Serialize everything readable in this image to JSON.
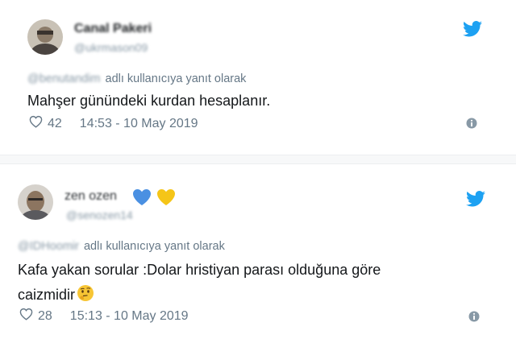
{
  "tweets": [
    {
      "name": "Canal Pakeri",
      "handle": "@ukrmason09",
      "reply_user": "@benutandim",
      "reply_suffix": "adlı kullanıcıya yanıt olarak",
      "text": "Mahşer günündeki kurdan hesaplanır.",
      "likes": "42",
      "timestamp": "14:53 - 10 May 2019"
    },
    {
      "name": "zen ozen",
      "handle": "@senozen14",
      "reply_user": "@IDHoomir",
      "reply_suffix": "adlı kullanıcıya yanıt olarak",
      "text_line1": "Kafa yakan sorular :Dolar hristiyan parası olduğuna göre",
      "text_line2": "caizmidir",
      "likes": "28",
      "timestamp": "15:13 - 10 May 2019"
    }
  ],
  "icons": {
    "brand": "twitter-bird-icon",
    "like": "heart-icon",
    "info": "info-icon",
    "emoji": "thinking-face-emoji",
    "badges": [
      "blue-heart-icon",
      "yellow-heart-icon"
    ]
  },
  "colors": {
    "twitter_blue": "#1da1f2",
    "meta_gray": "#657786",
    "badge_blue": "#4a90e2",
    "badge_yellow": "#f5c518"
  }
}
